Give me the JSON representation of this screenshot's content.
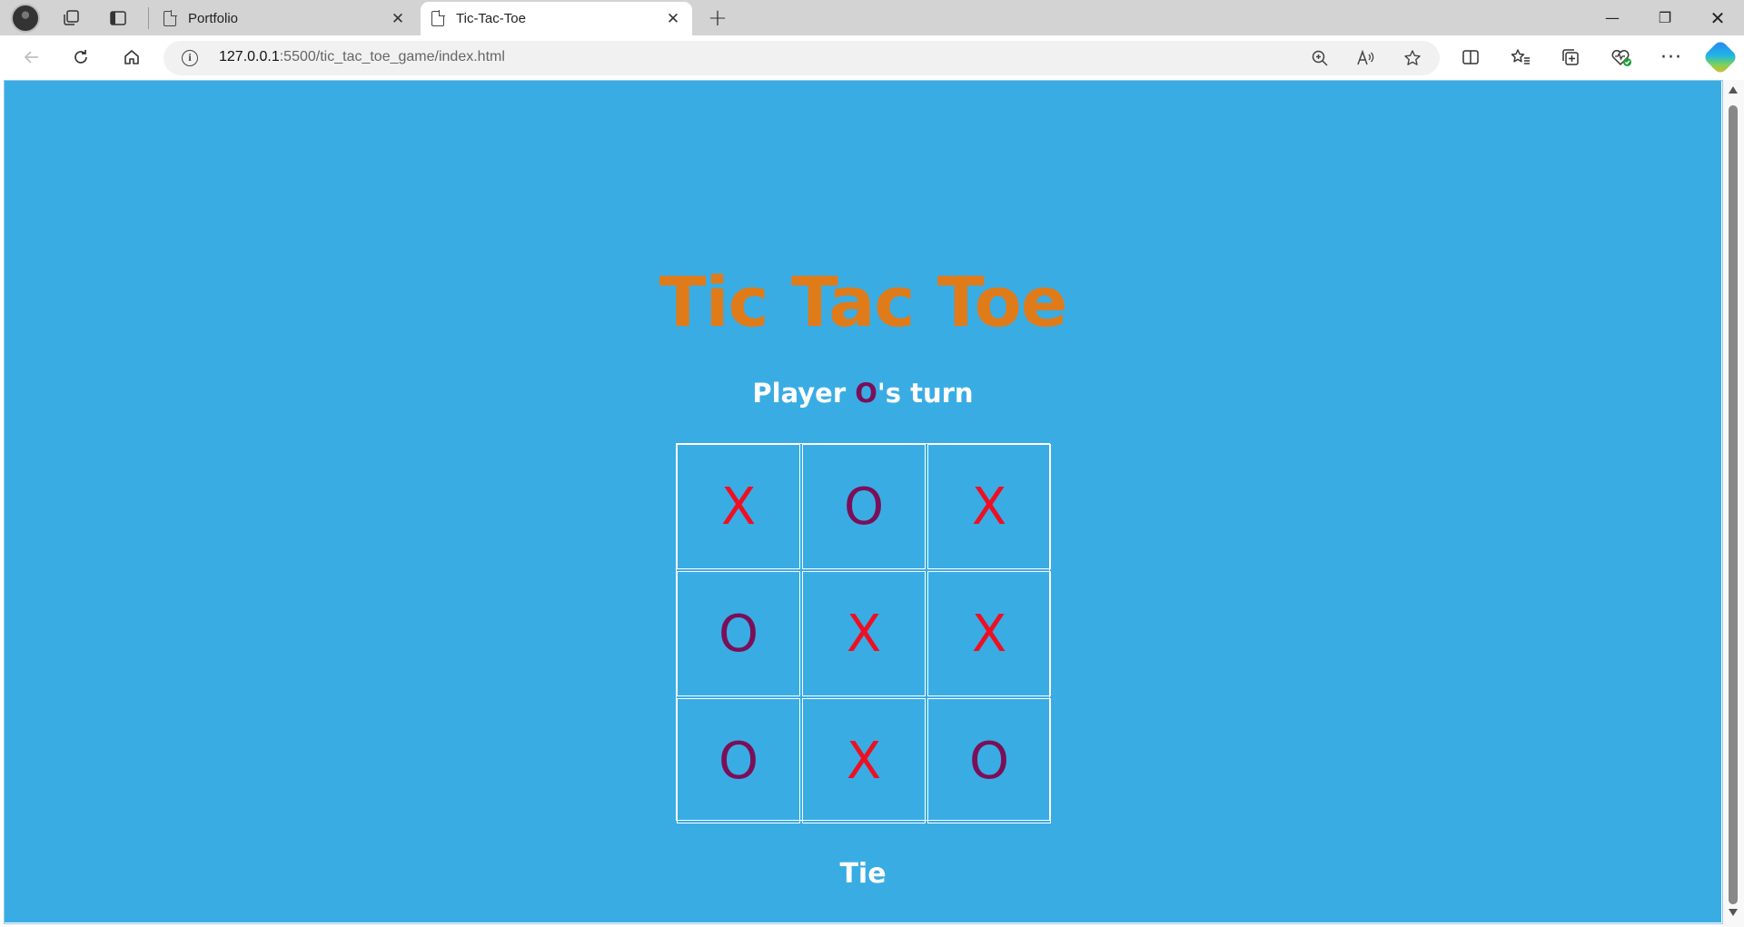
{
  "browser": {
    "tabs": [
      {
        "title": "Portfolio",
        "active": false
      },
      {
        "title": "Tic-Tac-Toe",
        "active": true
      }
    ],
    "address": {
      "host": "127.0.0.1",
      "rest": ":5500/tic_tac_toe_game/index.html"
    },
    "window_controls": {
      "minimize": "—",
      "maximize": "❐",
      "close": "✕"
    }
  },
  "page": {
    "background": "#3aace4",
    "title": "Tic Tac Toe",
    "title_color": "#e07b1a",
    "status": {
      "prefix": "Player ",
      "player": "O",
      "suffix": "'s turn"
    },
    "board": {
      "cells": [
        "X",
        "O",
        "X",
        "O",
        "X",
        "X",
        "O",
        "X",
        "O"
      ],
      "x_color": "#ee1022",
      "o_color": "#7a0f58"
    },
    "result": "Tie"
  },
  "icons": {
    "workspaces": "workspaces-icon",
    "tab_actions": "tab-actions-icon",
    "page": "page-icon",
    "back": "back-arrow-icon",
    "reload": "reload-icon",
    "home": "home-icon",
    "info": "info-icon",
    "zoom": "zoom-icon",
    "read_aloud": "read-aloud-icon",
    "favorite": "star-icon",
    "split": "split-screen-icon",
    "favorites": "favorites-icon",
    "collections": "collections-icon",
    "health": "browser-essentials-icon",
    "more": "more-icon",
    "copilot": "copilot-icon"
  }
}
